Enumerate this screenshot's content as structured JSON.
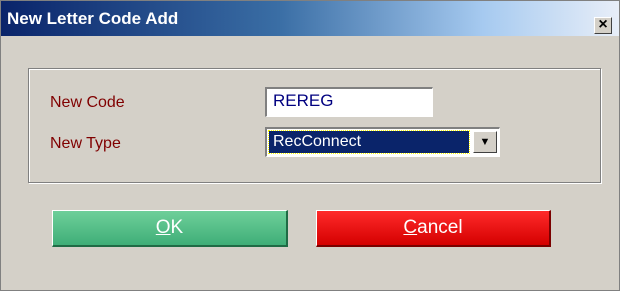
{
  "window": {
    "title": "New Letter Code Add",
    "close_glyph": "×"
  },
  "form": {
    "code_label": "New Code",
    "code_value": "REREG",
    "type_label": "New Type",
    "type_value": "RecConnect",
    "dropdown_arrow": "▼"
  },
  "buttons": {
    "ok": {
      "accel": "O",
      "rest": "K"
    },
    "cancel": {
      "accel": "C",
      "rest": "ancel"
    }
  },
  "colors": {
    "title_start": "#0a246a",
    "label": "#800000",
    "ok": "#4dbf86",
    "cancel": "#e60000",
    "selection": "#0a246a"
  }
}
